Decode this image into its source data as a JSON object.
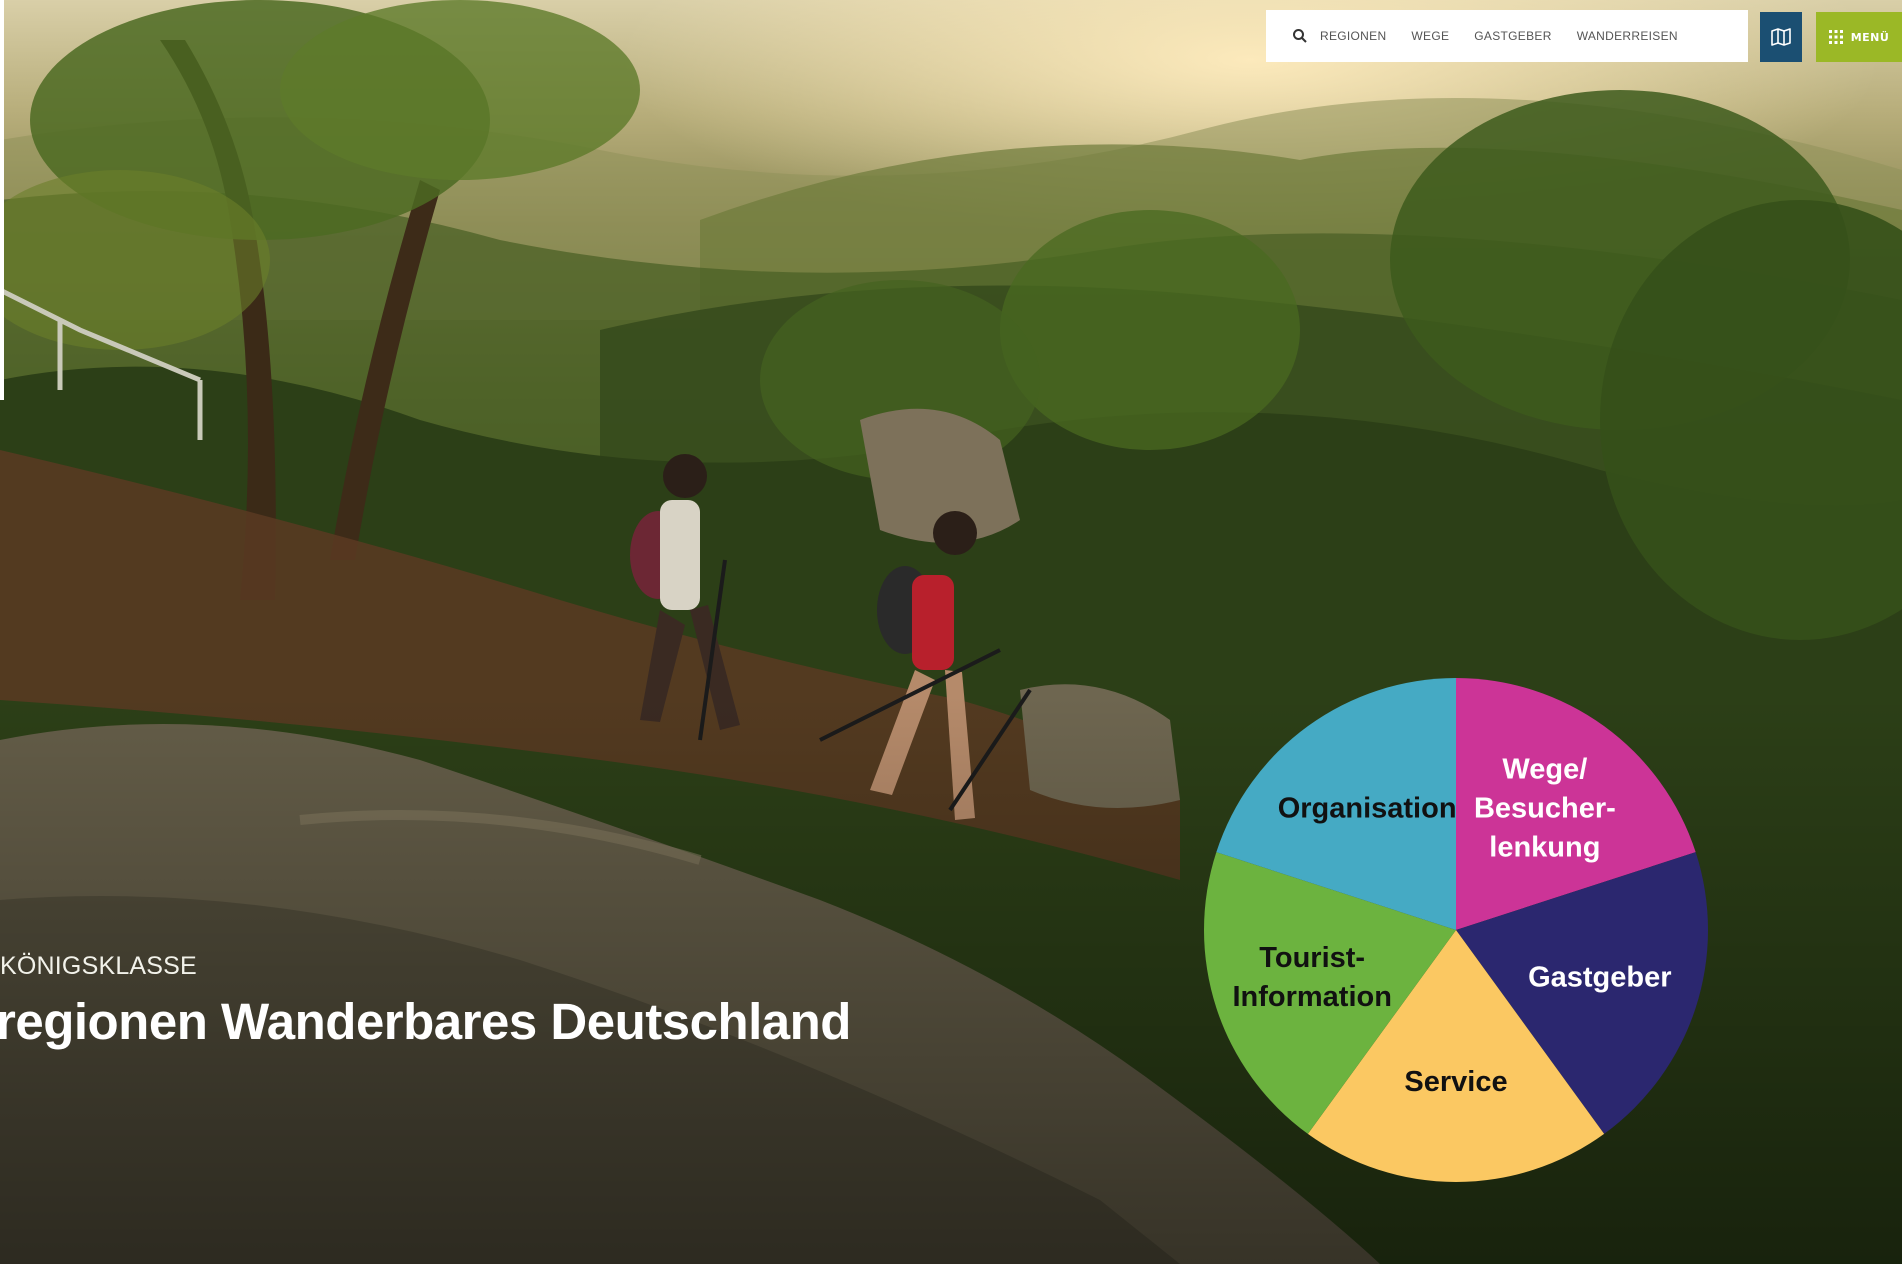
{
  "nav": {
    "search_icon": "search-icon",
    "links": [
      "REGIONEN",
      "WEGE",
      "GASTGEBER",
      "WANDERREISEN"
    ],
    "map_icon": "map-icon",
    "menu_icon": "grid-icon",
    "menu_label": "MENÜ",
    "colors": {
      "map": "#1b4f72",
      "menu": "#9bb826"
    }
  },
  "hero": {
    "kicker": "KÖNIGSKLASSE",
    "headline": "regionen Wanderbares Deutschland"
  },
  "chart_data": {
    "type": "pie",
    "slices": [
      {
        "label": "Wege/ Besucher- lenkung",
        "lines": [
          "Wege/",
          "Besucher-",
          "lenkung"
        ],
        "value": 20,
        "color": "#cc3497",
        "text_color": "#ffffff"
      },
      {
        "label": "Gastgeber",
        "lines": [
          "Gastgeber"
        ],
        "value": 20,
        "color": "#2b276f",
        "text_color": "#ffffff"
      },
      {
        "label": "Service",
        "lines": [
          "Service"
        ],
        "value": 20,
        "color": "#fbc862",
        "text_color": "#111111"
      },
      {
        "label": "Tourist- Information",
        "lines": [
          "Tourist-",
          "Information"
        ],
        "value": 20,
        "color": "#6cb33f",
        "text_color": "#111111"
      },
      {
        "label": "Organisation",
        "lines": [
          "Organisation"
        ],
        "value": 20,
        "color": "#45aac4",
        "text_color": "#111111"
      }
    ],
    "start_angle_deg": 0,
    "direction": "clockwise"
  }
}
